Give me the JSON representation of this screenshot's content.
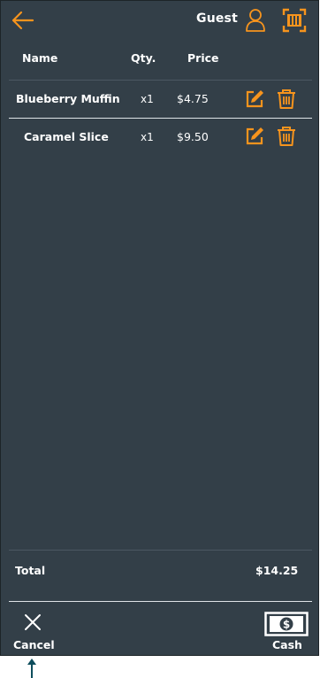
{
  "header": {
    "back_icon": "arrow-left-icon",
    "user_label": "Guest",
    "user_icon": "user-icon",
    "scan_icon": "barcode-scan-icon"
  },
  "columns": {
    "name": "Name",
    "qty": "Qty.",
    "price": "Price"
  },
  "items": [
    {
      "name": "Blueberry Muffin",
      "qty": "x1",
      "price": "$4.75"
    },
    {
      "name": "Caramel Slice",
      "qty": "x1",
      "price": "$9.50"
    }
  ],
  "total": {
    "label": "Total",
    "value": "$14.25"
  },
  "footer": {
    "cancel_label": "Cancel",
    "cash_label": "Cash"
  },
  "colors": {
    "background": "#333f48",
    "accent": "#f7941d",
    "text": "#ffffff",
    "pointer": "#0e4d5c"
  }
}
